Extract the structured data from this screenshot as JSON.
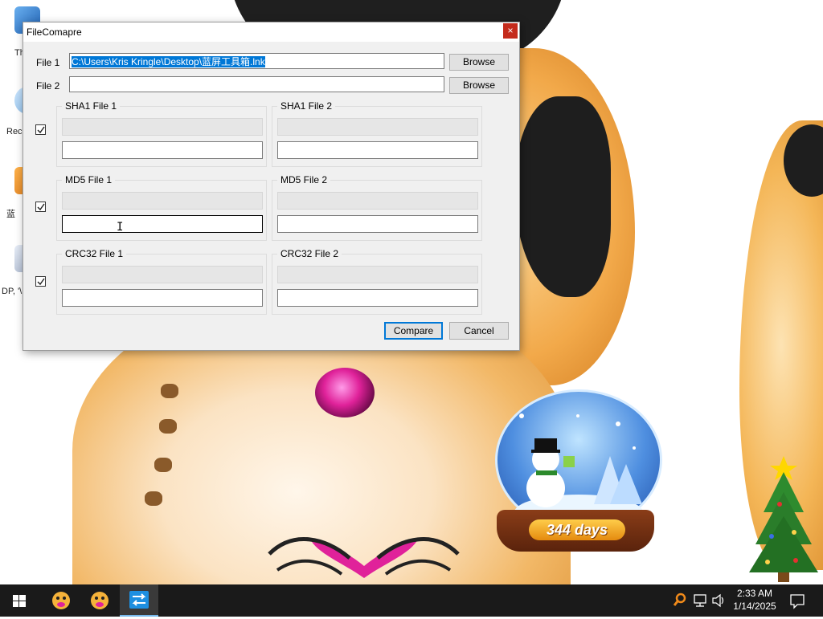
{
  "dialog": {
    "title": "FileComapre",
    "close_glyph": "×",
    "file1_label": "File 1",
    "file1_path": "C:\\Users\\Kris Kringle\\Desktop\\蓝屏工具箱.lnk",
    "file2_label": "File 2",
    "file2_path": "",
    "browse_label": "Browse",
    "groups": {
      "sha1_file1": "SHA1 File 1",
      "sha1_file2": "SHA1 File 2",
      "md5_file1": "MD5 File 1",
      "md5_file2": "MD5 File 2",
      "crc32_file1": "CRC32 File 1",
      "crc32_file2": "CRC32 File 2"
    },
    "checks": {
      "sha1": true,
      "md5": true,
      "crc32": true
    },
    "compare_label": "Compare",
    "cancel_label": "Cancel"
  },
  "wallpaper": {
    "days_badge": "344 days"
  },
  "desktop_icons": [
    {
      "label": "Th",
      "icon": "computer-icon"
    },
    {
      "label": "Rec",
      "icon": "recycle-bin-icon"
    },
    {
      "label": "蓝",
      "icon": "toolbox-icon"
    },
    {
      "label": "DP, '\\",
      "icon": "file-icon"
    }
  ],
  "taskbar": {
    "start_icon": "windows-logo-icon",
    "apps": [
      {
        "name": "app-mascot-1",
        "icon": "mascot-icon"
      },
      {
        "name": "app-mascot-2",
        "icon": "mascot-icon"
      },
      {
        "name": "file-compare",
        "icon": "compare-arrows-icon",
        "active": true
      }
    ],
    "tray_icons": [
      "search-tool-icon",
      "network-icon",
      "volume-icon"
    ],
    "time": "2:33 AM",
    "date": "1/14/2025",
    "notification_icon": "notification-icon"
  },
  "colors": {
    "accent": "#0078d7",
    "close": "#c42b1c",
    "taskbar": "#1a1a1a"
  }
}
